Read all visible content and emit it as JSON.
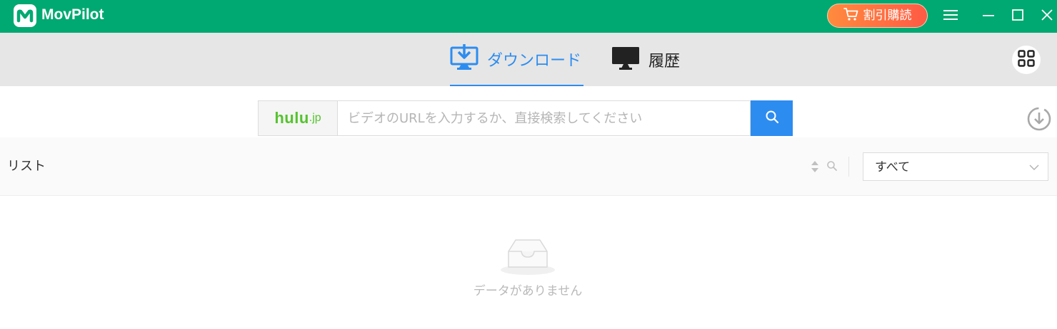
{
  "app": {
    "title": "MovPilot"
  },
  "titlebar": {
    "buy_label": "割引購読",
    "buttons": [
      "menu",
      "minimize",
      "maximize",
      "close"
    ]
  },
  "tabs": [
    {
      "label": "ダウンロード",
      "icon": "download-monitor-icon",
      "active": true
    },
    {
      "label": "履歴",
      "icon": "monitor-icon",
      "active": false
    }
  ],
  "search": {
    "site_name": "hulu",
    "site_suffix": ".jp",
    "placeholder": "ビデオのURLを入力するか、直接検索してください",
    "value": ""
  },
  "list": {
    "title": "リスト",
    "filter_value": "すべて",
    "empty_text": "データがありません"
  },
  "colors": {
    "brand": "#00a971",
    "accent": "#2d8cf0",
    "buy_start": "#ff8b3d",
    "buy_end": "#ff5a45",
    "hulu_green": "#55c32e"
  }
}
